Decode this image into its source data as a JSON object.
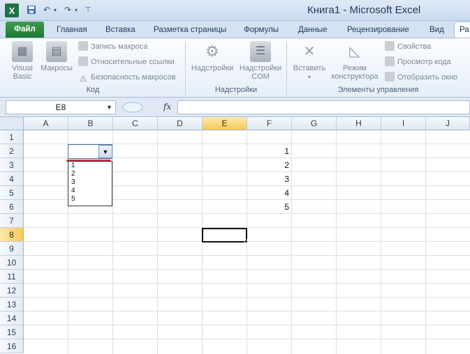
{
  "title": "Книга1  -  Microsoft Excel",
  "qat": {
    "logo": "X",
    "save_icon": "save-icon",
    "undo_icon": "undo-icon",
    "redo_icon": "redo-icon"
  },
  "tabs": [
    "Главная",
    "Вставка",
    "Разметка страницы",
    "Формулы",
    "Данные",
    "Рецензирование",
    "Вид"
  ],
  "tab_file": "Файл",
  "tab_active": "Ра",
  "ribbon": {
    "code": {
      "visual_basic": "Visual Basic",
      "macros": "Макросы",
      "record_macro": "Запись макроса",
      "relative_refs": "Относительные ссылки",
      "macro_security": "Безопасность макросов",
      "label": "Код"
    },
    "addins": {
      "addins": "Надстройки",
      "com_addins": "Надстройки COM",
      "label": "Надстройки"
    },
    "controls": {
      "insert": "Вставить",
      "design_mode": "Режим конструктора",
      "properties": "Свойства",
      "view_code": "Просмотр кода",
      "run_dialog": "Отобразить окно",
      "label": "Элементы управления"
    }
  },
  "formula_bar": {
    "name_box": "E8",
    "fx": "fx",
    "value": ""
  },
  "columns": [
    "A",
    "B",
    "C",
    "D",
    "E",
    "F",
    "G",
    "H",
    "I",
    "J"
  ],
  "rows": [
    "1",
    "2",
    "3",
    "4",
    "5",
    "6",
    "7",
    "8",
    "9",
    "10",
    "11",
    "12",
    "13",
    "14",
    "15",
    "16"
  ],
  "selected_cell": {
    "col": "E",
    "row": "8"
  },
  "cells_f": [
    "1",
    "2",
    "3",
    "4",
    "5"
  ],
  "dropdown": {
    "items": [
      "1",
      "2",
      "3",
      "4",
      "5"
    ]
  },
  "colors": {
    "file_tab": "#1d7a33",
    "selection_header": "#f5c95a",
    "dropdown_underline": "#c8323a"
  }
}
